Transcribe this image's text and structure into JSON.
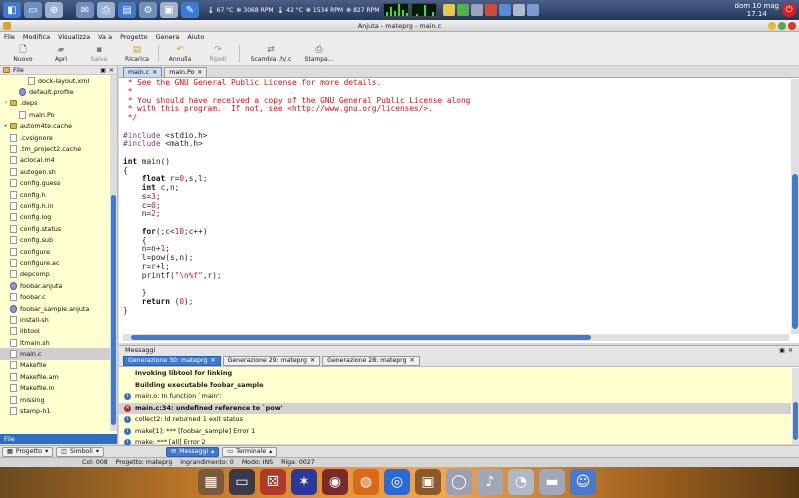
{
  "system_panel": {
    "temp1": "67 °C",
    "rpm1": "3068 RPM",
    "temp2": "42 °C",
    "rpm2": "1534 RPM",
    "rpm3": "827 RPM",
    "clock_date": "dom 10 mag",
    "clock_time": "17.14"
  },
  "window": {
    "title": "Anjuta - mateprg - main.c"
  },
  "menu": [
    "File",
    "Modifica",
    "Visualizza",
    "Va a",
    "Progetto",
    "Genera",
    "Aiuto"
  ],
  "toolbar": {
    "new": "Nuovo",
    "open": "Apri",
    "save": "Salva",
    "reload": "Ricarica",
    "undo": "Annulla",
    "redo": "Ripeti",
    "swap": "Scambia .h/.c",
    "print": "Stampa..."
  },
  "file_panel": {
    "title": "File",
    "items": [
      {
        "name": "dock-layout.xml",
        "type": "doc",
        "indent": 2,
        "expander": ""
      },
      {
        "name": "default.profile",
        "type": "proj",
        "indent": 1,
        "expander": ""
      },
      {
        "name": ".deps",
        "type": "folder",
        "indent": 0,
        "expander": "▿"
      },
      {
        "name": "main.Po",
        "type": "doc",
        "indent": 1,
        "expander": ""
      },
      {
        "name": "autom4te.cache",
        "type": "folder",
        "indent": 0,
        "expander": "▸"
      },
      {
        "name": ".cvsignore",
        "type": "doc",
        "indent": 0,
        "expander": ""
      },
      {
        "name": ".tm_project2.cache",
        "type": "doc",
        "indent": 0,
        "expander": ""
      },
      {
        "name": "aclocal.m4",
        "type": "doc",
        "indent": 0,
        "expander": ""
      },
      {
        "name": "autogen.sh",
        "type": "doc",
        "indent": 0,
        "expander": ""
      },
      {
        "name": "config.guess",
        "type": "doc",
        "indent": 0,
        "expander": ""
      },
      {
        "name": "config.h",
        "type": "doc",
        "indent": 0,
        "expander": ""
      },
      {
        "name": "config.h.in",
        "type": "doc",
        "indent": 0,
        "expander": ""
      },
      {
        "name": "config.log",
        "type": "doc",
        "indent": 0,
        "expander": ""
      },
      {
        "name": "config.status",
        "type": "doc",
        "indent": 0,
        "expander": ""
      },
      {
        "name": "config.sub",
        "type": "doc",
        "indent": 0,
        "expander": ""
      },
      {
        "name": "configure",
        "type": "doc",
        "indent": 0,
        "expander": ""
      },
      {
        "name": "configure.ac",
        "type": "doc",
        "indent": 0,
        "expander": ""
      },
      {
        "name": "depcomp",
        "type": "doc",
        "indent": 0,
        "expander": ""
      },
      {
        "name": "foobar.anjuta",
        "type": "proj",
        "indent": 0,
        "expander": ""
      },
      {
        "name": "foobar.c",
        "type": "doc",
        "indent": 0,
        "expander": ""
      },
      {
        "name": "foobar_sample.anjuta",
        "type": "proj",
        "indent": 0,
        "expander": ""
      },
      {
        "name": "install-sh",
        "type": "doc",
        "indent": 0,
        "expander": ""
      },
      {
        "name": "libtool",
        "type": "doc",
        "indent": 0,
        "expander": ""
      },
      {
        "name": "ltmain.sh",
        "type": "doc",
        "indent": 0,
        "expander": ""
      },
      {
        "name": "main.c",
        "type": "doc",
        "indent": 0,
        "expander": "",
        "selected": true
      },
      {
        "name": "Makefile",
        "type": "doc",
        "indent": 0,
        "expander": ""
      },
      {
        "name": "Makefile.am",
        "type": "doc",
        "indent": 0,
        "expander": ""
      },
      {
        "name": "Makefile.in",
        "type": "doc",
        "indent": 0,
        "expander": ""
      },
      {
        "name": "missing",
        "type": "doc",
        "indent": 0,
        "expander": ""
      },
      {
        "name": "stamp-h1",
        "type": "doc",
        "indent": 0,
        "expander": ""
      }
    ],
    "bottom_tab": "File"
  },
  "editor": {
    "tabs": [
      {
        "label": "main.c",
        "active": true
      },
      {
        "label": "main.Po",
        "active": false
      }
    ],
    "lines": [
      [
        [
          " * See the GNU General Public License for more details.",
          "comment"
        ]
      ],
      [
        [
          " *",
          "comment"
        ]
      ],
      [
        [
          " * You should have received a copy of the GNU General Public License along",
          "comment"
        ]
      ],
      [
        [
          " * with this program.  If not, see <http://www.gnu.org/licenses/>.",
          "comment"
        ]
      ],
      [
        [
          " */",
          "comment"
        ]
      ],
      [
        [
          "",
          "plain"
        ]
      ],
      [
        [
          "#include",
          "pre"
        ],
        [
          " <stdio.h>",
          "plain"
        ]
      ],
      [
        [
          "#include",
          "pre"
        ],
        [
          " <math.h>",
          "plain"
        ]
      ],
      [
        [
          "",
          "plain"
        ]
      ],
      [
        [
          "int",
          "kw"
        ],
        [
          " main()",
          "plain"
        ]
      ],
      [
        [
          "{",
          "plain"
        ]
      ],
      [
        [
          "    ",
          "plain"
        ],
        [
          "float",
          "kw"
        ],
        [
          " r=",
          "plain"
        ],
        [
          "0",
          "num"
        ],
        [
          ",s,l;",
          "plain"
        ]
      ],
      [
        [
          "    ",
          "plain"
        ],
        [
          "int",
          "kw"
        ],
        [
          " c,n;",
          "plain"
        ]
      ],
      [
        [
          "    s=",
          "plain"
        ],
        [
          "3",
          "num"
        ],
        [
          ";",
          "plain"
        ]
      ],
      [
        [
          "    c=",
          "plain"
        ],
        [
          "0",
          "num"
        ],
        [
          ";",
          "plain"
        ]
      ],
      [
        [
          "    n=",
          "plain"
        ],
        [
          "2",
          "num"
        ],
        [
          ";",
          "plain"
        ]
      ],
      [
        [
          "",
          "plain"
        ]
      ],
      [
        [
          "    ",
          "plain"
        ],
        [
          "for",
          "kw"
        ],
        [
          "(;c<",
          "plain"
        ],
        [
          "10",
          "num"
        ],
        [
          ";c++)",
          "plain"
        ]
      ],
      [
        [
          "    {",
          "plain"
        ]
      ],
      [
        [
          "    n=n+",
          "plain"
        ],
        [
          "1",
          "num"
        ],
        [
          ";",
          "plain"
        ]
      ],
      [
        [
          "    l=pow(s,n);",
          "plain"
        ]
      ],
      [
        [
          "    r=r+l;",
          "plain"
        ]
      ],
      [
        [
          "    printf(",
          "plain"
        ],
        [
          "\"\\n%f\"",
          "str"
        ],
        [
          ",r);",
          "plain"
        ]
      ],
      [
        [
          "",
          "plain"
        ]
      ],
      [
        [
          "    }",
          "plain"
        ]
      ],
      [
        [
          "    ",
          "plain"
        ],
        [
          "return",
          "kw"
        ],
        [
          " (",
          "plain"
        ],
        [
          "0",
          "num"
        ],
        [
          ");",
          "plain"
        ]
      ],
      [
        [
          "}",
          "plain"
        ]
      ]
    ]
  },
  "messages": {
    "title": "Messaggi",
    "tabs": [
      {
        "label": "Generazione 30: mateprg",
        "active": true
      },
      {
        "label": "Generazione 29: mateprg",
        "active": false
      },
      {
        "label": "Generazione 28: mateprg",
        "active": false
      }
    ],
    "lines": [
      {
        "text": "Invoking libtool for linking",
        "style": "bold",
        "icon": ""
      },
      {
        "text": "Building executable foobar_sample",
        "style": "bold",
        "icon": ""
      },
      {
        "text": "main.o: In function `main':",
        "style": "normal",
        "icon": "info"
      },
      {
        "text": "main.c:34: undefined reference to `pow'",
        "style": "err",
        "icon": "error"
      },
      {
        "text": "collect2: ld returned 1 exit status",
        "style": "normal",
        "icon": "info"
      },
      {
        "text": "make[1]: *** [foobar_sample] Error 1",
        "style": "normal",
        "icon": "info"
      },
      {
        "text": "make: *** [all] Error 2",
        "style": "normal",
        "icon": "info"
      }
    ]
  },
  "dock_tabs": {
    "project": "Progetto",
    "symbols": "Simboli",
    "messages": "Messaggi",
    "terminal": "Terminale"
  },
  "status": {
    "col": "Col: 008",
    "project": "Progetto: mateprg",
    "zoom": "Ingrandimento: 0",
    "mode": "Modo: INS",
    "line": "Riga: 0027"
  },
  "colors": {
    "accent": "#3f7ad0",
    "comment": "#d01010",
    "panel_bg": "#ffffd0"
  }
}
